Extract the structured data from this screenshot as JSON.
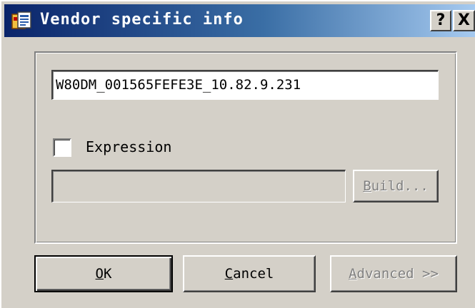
{
  "window": {
    "title": "Vendor specific info",
    "help_glyph": "?",
    "close_glyph": "X"
  },
  "vendor_info": {
    "value": "W80DM_001565FEFE3E_10.82.9.231"
  },
  "expression": {
    "label": "Expression",
    "checked": false,
    "value": ""
  },
  "buttons": {
    "build": {
      "accel": "B",
      "rest": "uild..."
    },
    "ok": {
      "accel": "O",
      "rest": "K"
    },
    "cancel": {
      "accel": "C",
      "rest": "ancel"
    },
    "advanced": {
      "accel": "A",
      "rest": "dvanced >>"
    }
  },
  "colors": {
    "title_gradient_start": "#0a246a",
    "title_gradient_end": "#a6caf0",
    "dialog_face": "#d4d0c8"
  },
  "icons": {
    "title": "window-app-icon",
    "help": "help-icon",
    "close": "close-icon"
  }
}
